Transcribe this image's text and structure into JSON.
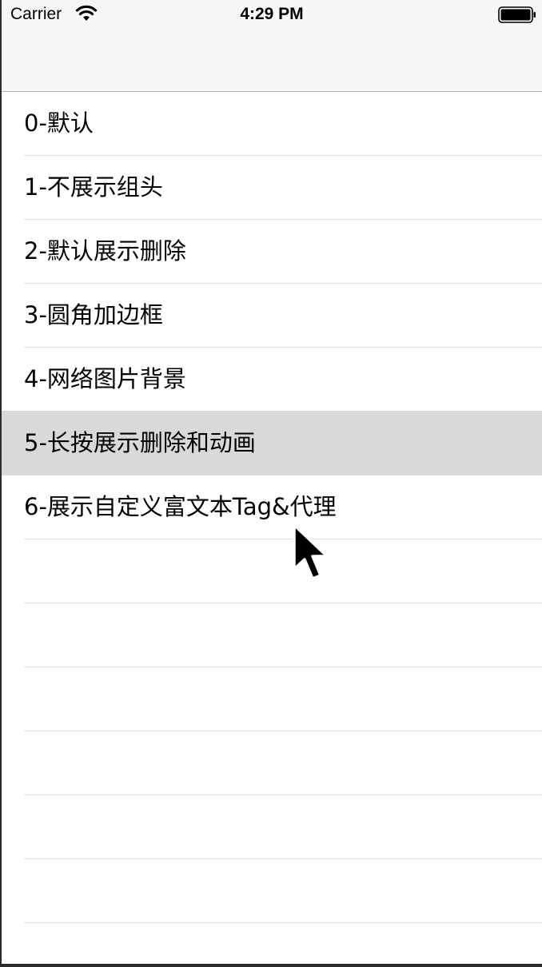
{
  "status_bar": {
    "carrier": "Carrier",
    "time": "4:29 PM",
    "wifi_icon": "wifi-icon",
    "battery_icon": "battery-icon"
  },
  "list": {
    "items": [
      {
        "label": "0-默认"
      },
      {
        "label": "1-不展示组头"
      },
      {
        "label": "2-默认展示删除"
      },
      {
        "label": "3-圆角加边框"
      },
      {
        "label": "4-网络图片背景"
      },
      {
        "label": "5-长按展示删除和动画",
        "selected": true
      },
      {
        "label": "6-展示自定义富文本Tag&代理"
      }
    ],
    "selected_index": 5,
    "colors": {
      "selected_background": "#d9d9d9",
      "separator": "#e0e0e0",
      "nav_background": "#f7f7f7"
    }
  },
  "cursor_icon": "mouse-pointer-icon"
}
